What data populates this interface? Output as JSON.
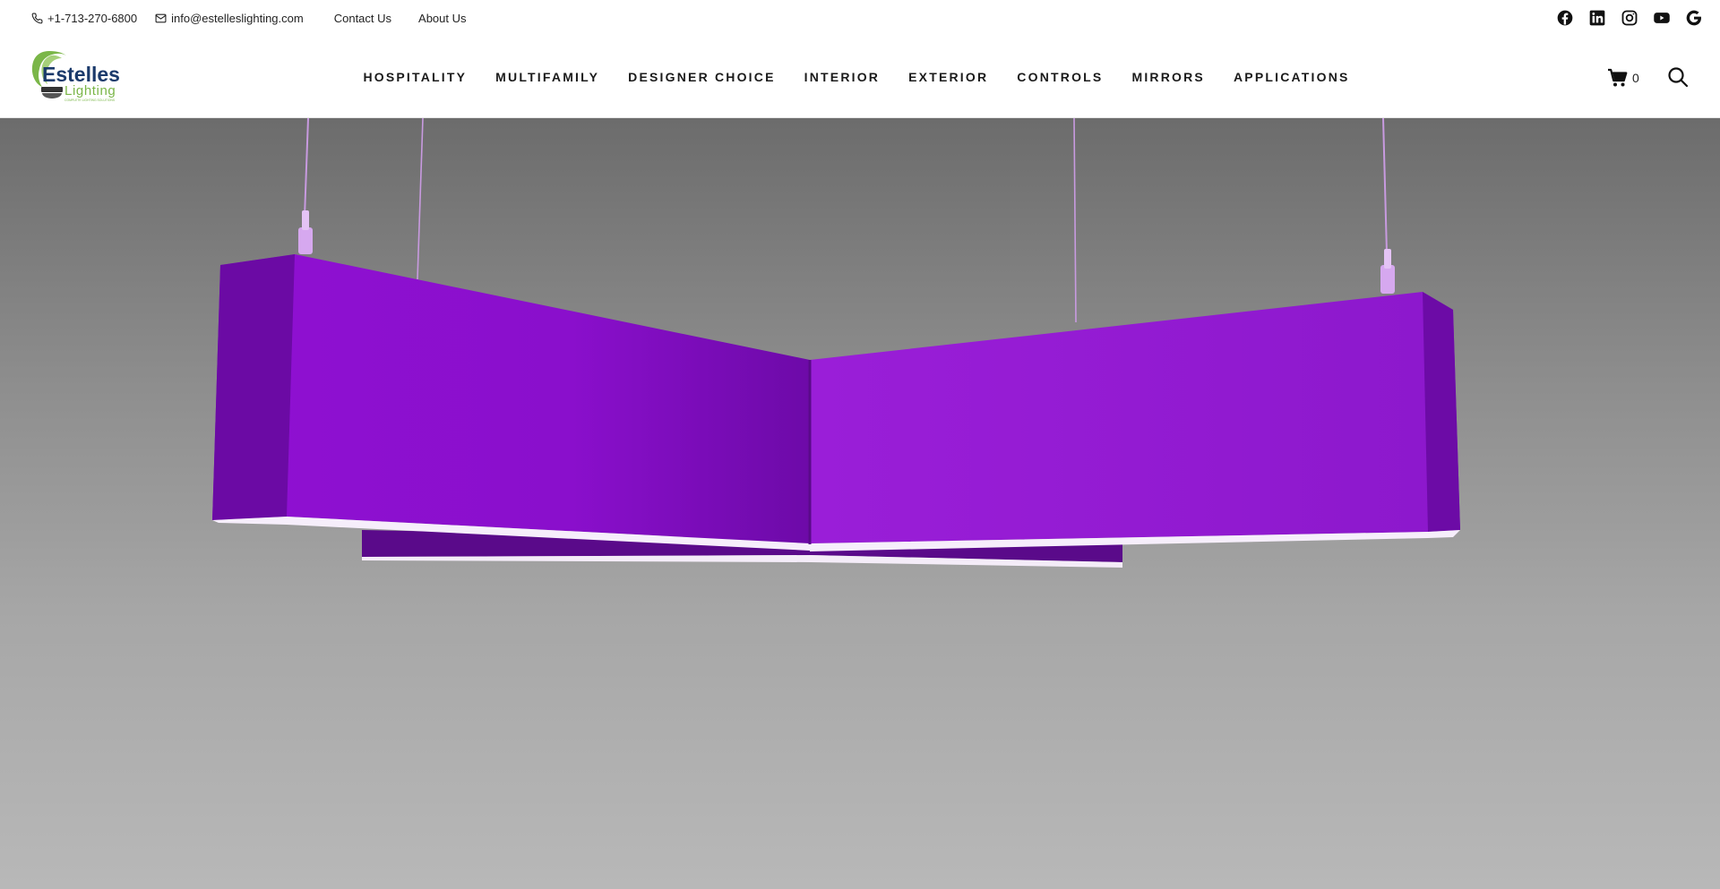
{
  "topbar": {
    "phone": "+1-713-270-6800",
    "email": "info@estelleslighting.com",
    "links": [
      "Contact Us",
      "About Us"
    ],
    "social_icons": [
      "facebook-icon",
      "linkedin-icon",
      "instagram-icon",
      "youtube-icon",
      "google-icon"
    ]
  },
  "logo": {
    "line1": "Estelles",
    "line2": "Lighting",
    "tagline": "COMPLETE LIGHTING SOLUTIONS",
    "colors": {
      "green": "#7ab648",
      "navy": "#1b3a6b",
      "dark": "#333333"
    }
  },
  "nav": {
    "items": [
      "HOSPITALITY",
      "MULTIFAMILY",
      "DESIGNER CHOICE",
      "INTERIOR",
      "EXTERIOR",
      "CONTROLS",
      "MIRRORS",
      "APPLICATIONS"
    ]
  },
  "cart": {
    "count": "0"
  },
  "hero": {
    "image": "purple-y-shaped-pendant-light",
    "colors": {
      "purple": "#9a1ad8",
      "purple_dark": "#5e0a8c",
      "background": "#8e8e8e"
    }
  }
}
